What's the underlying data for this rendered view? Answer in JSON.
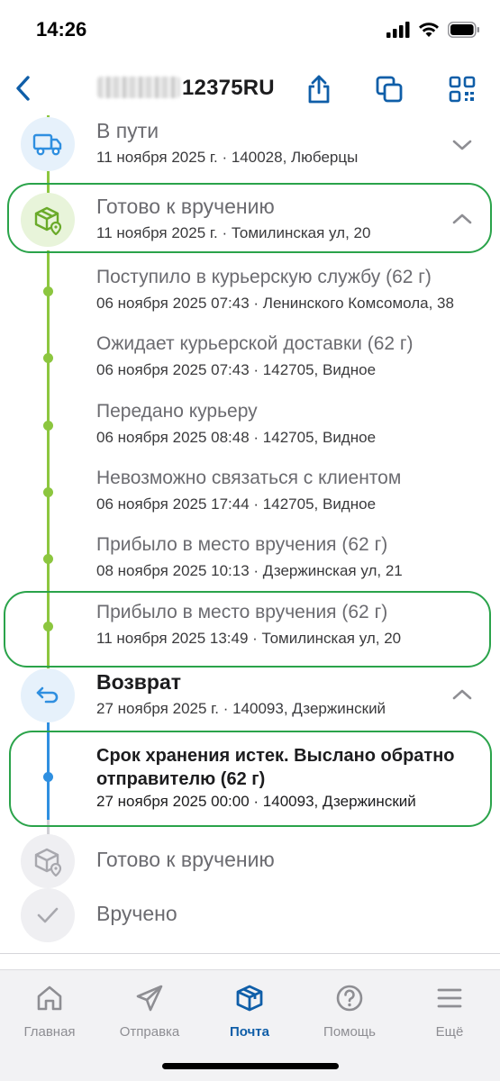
{
  "status": {
    "time": "14:26"
  },
  "nav": {
    "title_suffix": "12375RU"
  },
  "stages": [
    {
      "title": "В пути",
      "subtitle": "11 ноября 2025 г. · 140028, Люберцы",
      "state": "done"
    },
    {
      "title": "Готово к вручению",
      "subtitle": "11 ноября 2025 г. · Томилинская ул, 20",
      "state": "done"
    },
    {
      "title": "Возврат",
      "subtitle": "27 ноября 2025 г. · 140093, Дзержинский",
      "state": "current"
    },
    {
      "title": "Готово к вручению",
      "state": "pending"
    },
    {
      "title": "Вручено",
      "state": "pending"
    }
  ],
  "ready_events": [
    {
      "title": "Поступило в курьерскую службу (62 г)",
      "subtitle": "06 ноября 2025 07:43 · Ленинского Комсомола, 38"
    },
    {
      "title": "Ожидает курьерской доставки (62 г)",
      "subtitle": "06 ноября 2025 07:43 · 142705, Видное"
    },
    {
      "title": "Передано курьеру",
      "subtitle": "06 ноября 2025 08:48 · 142705, Видное"
    },
    {
      "title": "Невозможно связаться с клиентом",
      "subtitle": "06 ноября 2025 17:44 · 142705, Видное"
    },
    {
      "title": "Прибыло в место вручения (62 г)",
      "subtitle": "08 ноября 2025 10:13 · Дзержинская ул, 21"
    },
    {
      "title": "Прибыло в место вручения (62 г)",
      "subtitle": "11 ноября 2025 13:49 · Томилинская ул, 20"
    }
  ],
  "return_events": [
    {
      "title": "Срок хранения истек. Выслано обратно отправителю (62 г)",
      "subtitle": "27 ноября 2025 00:00 · 140093, Дзержинский"
    }
  ],
  "tabs": [
    {
      "label": "Главная",
      "icon": "home-icon",
      "active": false
    },
    {
      "label": "Отправка",
      "icon": "paper-plane-icon",
      "active": false
    },
    {
      "label": "Почта",
      "icon": "parcel-box-icon",
      "active": true
    },
    {
      "label": "Помощь",
      "icon": "help-circle-icon",
      "active": false
    },
    {
      "label": "Ещё",
      "icon": "menu-icon",
      "active": false
    }
  ],
  "colors": {
    "accent": "#0f5ea8",
    "timeline_green": "#8cc63f",
    "timeline_blue": "#2f8fe0",
    "highlight_green": "#2aa34a",
    "icon_bg_done": "#e8f4da",
    "icon_bg_current": "#e6f1fb",
    "icon_bg_pending": "#efeff2"
  }
}
